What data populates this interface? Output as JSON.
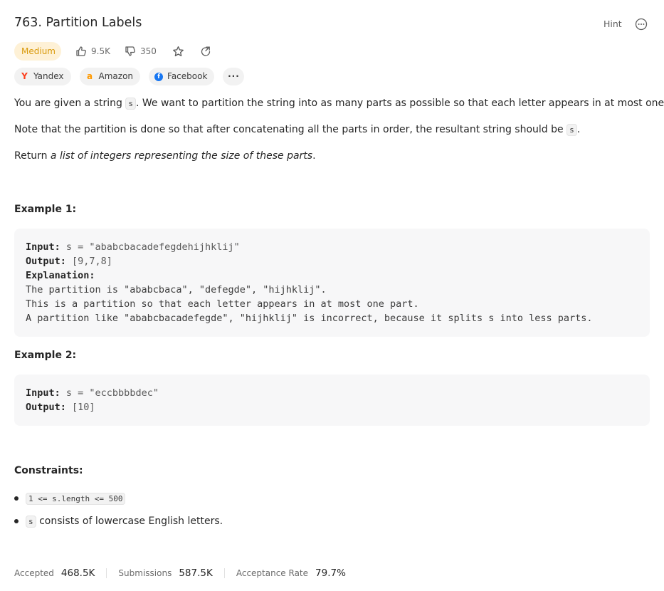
{
  "header": {
    "title": "763. Partition Labels",
    "hint_label": "Hint"
  },
  "meta": {
    "difficulty": "Medium",
    "likes": "9.5K",
    "dislikes": "350"
  },
  "tags": [
    {
      "label": "Yandex",
      "logo": "Y",
      "color": "#fc3f1d"
    },
    {
      "label": "Amazon",
      "logo": "a",
      "color": "#ff9900"
    },
    {
      "label": "Facebook",
      "logo": "f",
      "color": "#1877f2"
    }
  ],
  "more_label": "···",
  "description": {
    "p1_before": "You are given a string ",
    "p1_code": "s",
    "p1_after": ". We want to partition the string into as many parts as possible so that each letter appears in at most one part.",
    "p2_before": "Note that the partition is done so that after concatenating all the parts in order, the resultant string should be ",
    "p2_code": "s",
    "p2_after": ".",
    "p3_before": "Return ",
    "p3_em": "a list of integers representing the size of these parts",
    "p3_after": "."
  },
  "example1": {
    "heading": "Example 1:",
    "input_label": "Input:",
    "input_value": " s = \"ababcbacadefegdehijhklij\"",
    "output_label": "Output:",
    "output_value": " [9,7,8]",
    "explanation_label": "Explanation:",
    "explanation_lines": [
      "The partition is \"ababcbaca\", \"defegde\", \"hijhklij\".",
      "This is a partition so that each letter appears in at most one part.",
      "A partition like \"ababcbacadefegde\", \"hijhklij\" is incorrect, because it splits s into less parts."
    ]
  },
  "example2": {
    "heading": "Example 2:",
    "input_label": "Input:",
    "input_value": " s = \"eccbbbbdec\"",
    "output_label": "Output:",
    "output_value": " [10]"
  },
  "constraints": {
    "heading": "Constraints:",
    "c1_code": "1 <= s.length <= 500",
    "c2_code": "s",
    "c2_text": " consists of lowercase English letters."
  },
  "footer": {
    "accepted_label": "Accepted",
    "accepted_value": "468.5K",
    "submissions_label": "Submissions",
    "submissions_value": "587.5K",
    "rate_label": "Acceptance Rate",
    "rate_value": "79.7%"
  }
}
